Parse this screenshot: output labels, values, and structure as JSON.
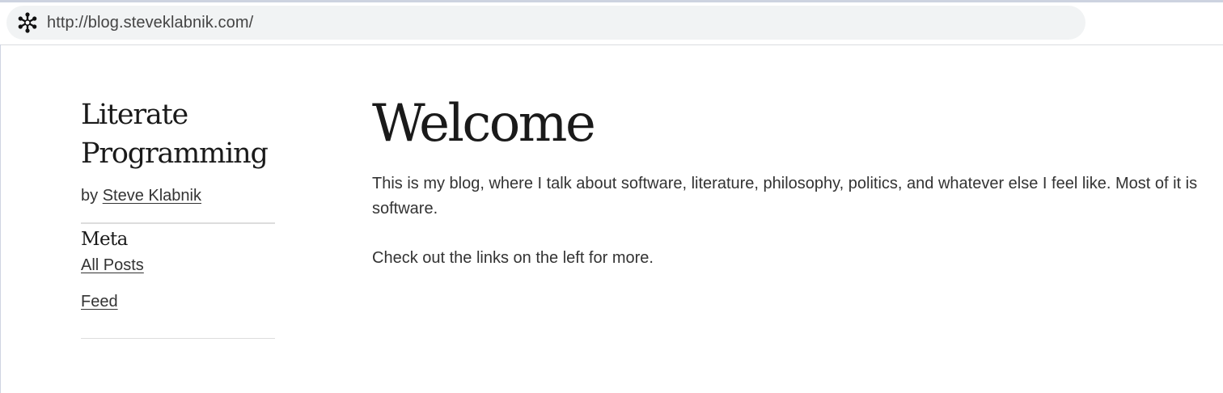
{
  "browser": {
    "url": "http://blog.steveklabnik.com/",
    "site_icon": "snowflake-icon"
  },
  "sidebar": {
    "title_line1": "Literate",
    "title_line2": "Programming",
    "byline_prefix": "by",
    "author": "Steve Klabnik",
    "meta_heading": "Meta",
    "links": [
      {
        "label": "All Posts"
      },
      {
        "label": "Feed"
      }
    ]
  },
  "main": {
    "title": "Welcome",
    "paragraphs": [
      "This is my blog, where I talk about software, literature, philosophy, politics, and whatever else I feel like. Most of it is software.",
      "Check out the links on the left for more."
    ]
  },
  "colors": {
    "text": "#333333",
    "heading": "#1a1a1a",
    "address_bar_bg": "#f1f3f4",
    "rule": "#dddddd"
  }
}
